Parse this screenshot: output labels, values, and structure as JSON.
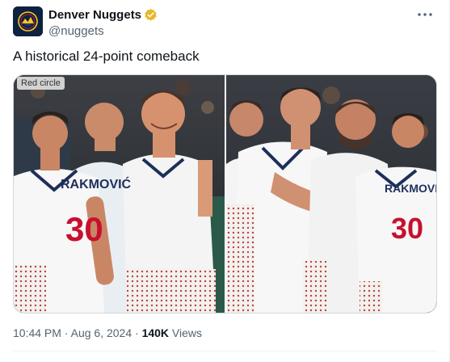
{
  "account": {
    "display_name": "Denver Nuggets",
    "handle": "@nuggets"
  },
  "tweet": {
    "text": "A historical 24-point comeback"
  },
  "media": {
    "alt_badge": "Red circle",
    "left_jersey_name": "RAKMOVIĆ",
    "left_jersey_number": "30",
    "right_jersey_name": "RAKMOVIĆ",
    "right_jersey_number": "30"
  },
  "meta": {
    "time": "10:44 PM",
    "separator": " · ",
    "date": "Aug 6, 2024",
    "separator2": " · ",
    "views_count": "140K",
    "views_label": " Views"
  },
  "colors": {
    "brand_navy": "#0e2240",
    "brand_gold": "#fec524",
    "verified_gold": "#e8b829",
    "jersey_red": "#c8102e",
    "text_secondary": "#536471"
  },
  "icons": {
    "avatar": "nuggets-logo-icon",
    "verified": "verified-badge-icon",
    "more": "more-dots-icon"
  }
}
